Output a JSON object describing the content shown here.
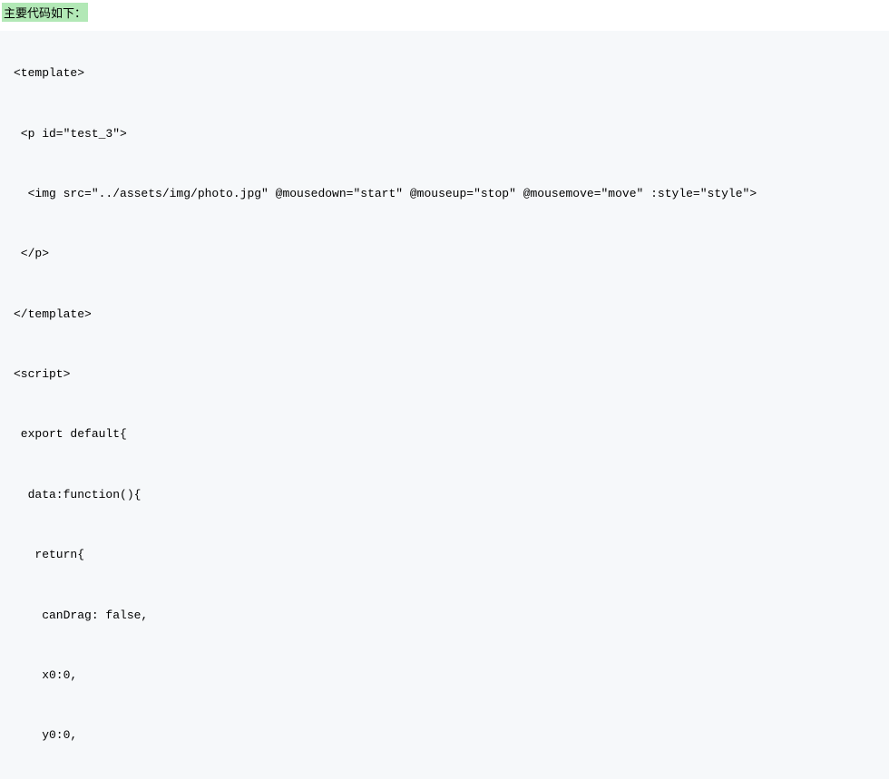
{
  "heading": "主要代码如下：",
  "code": {
    "lines": [
      "<template>",
      " <p id=\"test_3\">",
      "  <img src=\"../assets/img/photo.jpg\" @mousedown=\"start\" @mouseup=\"stop\" @mousemove=\"move\" :style=\"style\">",
      " </p>",
      "</template>",
      "<script>",
      " export default{",
      "  data:function(){",
      "   return{",
      "    canDrag: false,",
      "    x0:0,",
      "    y0:0,"
    ]
  }
}
